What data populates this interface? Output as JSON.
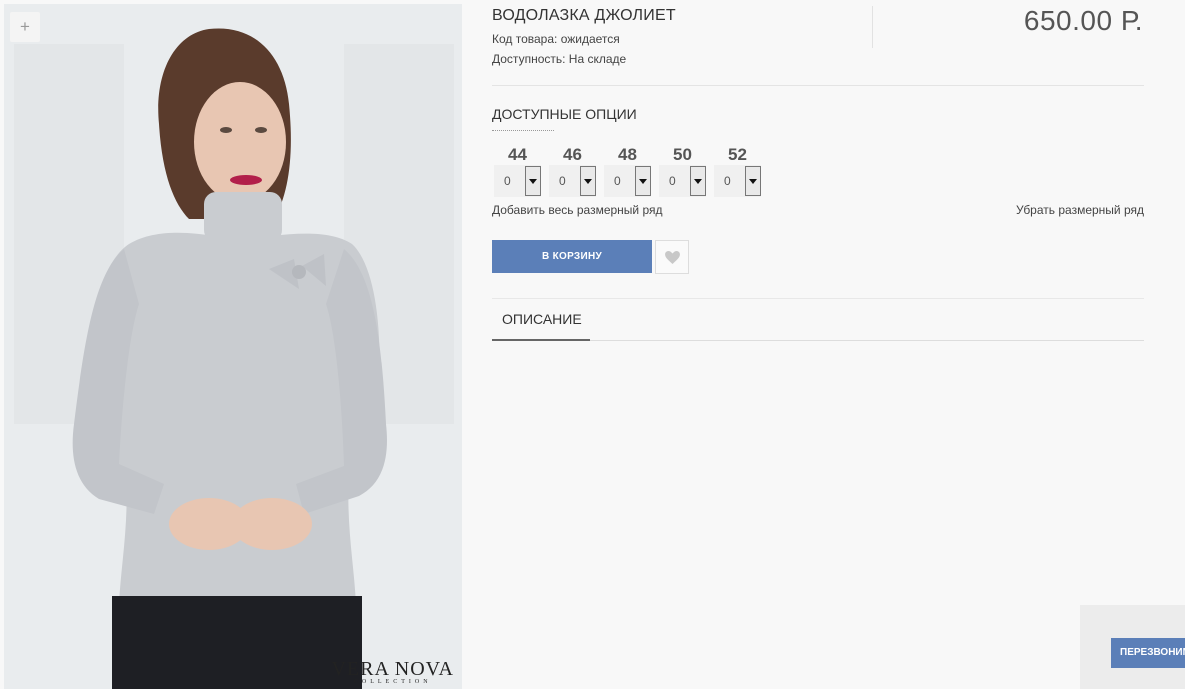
{
  "product": {
    "title": "ВОДОЛАЗКА ДЖОЛИЕТ",
    "code_line": "Код товара: ожидается",
    "availability_line": "Доступность: На складе",
    "price": "650.00 Р."
  },
  "gallery": {
    "zoom_label": "+",
    "brand_name": "VERA NOVA",
    "brand_sub": "COLLECTION"
  },
  "options": {
    "title": "ДОСТУПНЫЕ ОПЦИИ",
    "sizes": [
      {
        "label": "44",
        "qty": "0"
      },
      {
        "label": "46",
        "qty": "0"
      },
      {
        "label": "48",
        "qty": "0"
      },
      {
        "label": "50",
        "qty": "0"
      },
      {
        "label": "52",
        "qty": "0"
      }
    ],
    "add_all_label": "Добавить весь размерный ряд",
    "remove_all_label": "Убрать размерный ряд"
  },
  "actions": {
    "cart_label": "В КОРЗИНУ",
    "wishlist_icon": "heart-icon"
  },
  "tabs": [
    {
      "label": "ОПИСАНИЕ",
      "active": true
    }
  ],
  "callback": {
    "label": "ПЕРЕЗВОНИМ"
  },
  "colors": {
    "accent": "#5b7fb8",
    "sweater": "#c9ccd0",
    "pants": "#1e1f24"
  }
}
